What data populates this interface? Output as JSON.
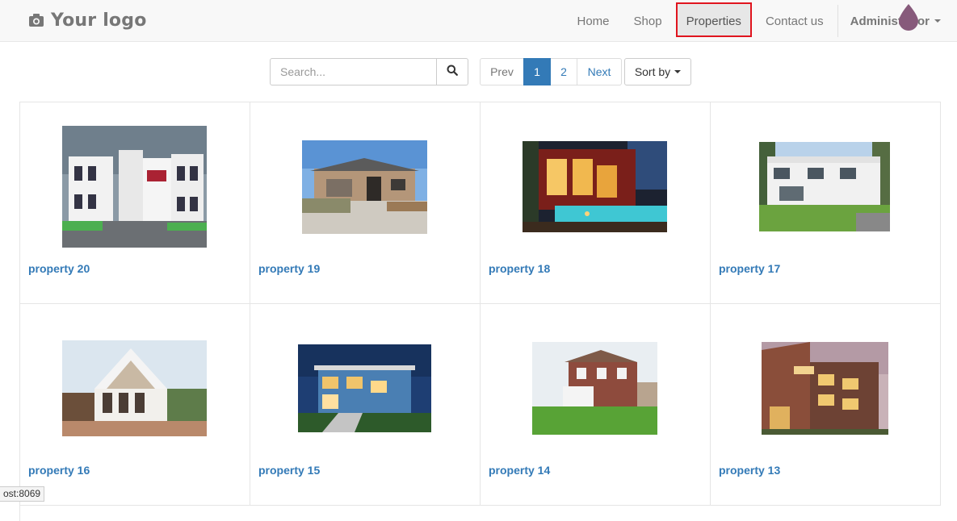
{
  "brand": {
    "logo_text": "Your logo",
    "icon": "camera-icon"
  },
  "nav": {
    "items": [
      {
        "label": "Home"
      },
      {
        "label": "Shop"
      },
      {
        "label": "Properties",
        "active": true
      },
      {
        "label": "Contact us"
      }
    ],
    "user_label": "Administrator"
  },
  "search": {
    "placeholder": "Search...",
    "value": "",
    "button_icon": "search-icon"
  },
  "pager": {
    "prev": "Prev",
    "pages": [
      "1",
      "2"
    ],
    "current": "1",
    "next": "Next"
  },
  "sort": {
    "label": "Sort by"
  },
  "properties": [
    {
      "name": "property 20"
    },
    {
      "name": "property 19"
    },
    {
      "name": "property 18"
    },
    {
      "name": "property 17"
    },
    {
      "name": "property 16"
    },
    {
      "name": "property 15"
    },
    {
      "name": "property 14"
    },
    {
      "name": "property 13"
    }
  ],
  "status_bar": {
    "text": "ost:8069"
  },
  "colors": {
    "link": "#337ab7",
    "active_outline": "#e0141e",
    "badge": "#875a7b"
  }
}
